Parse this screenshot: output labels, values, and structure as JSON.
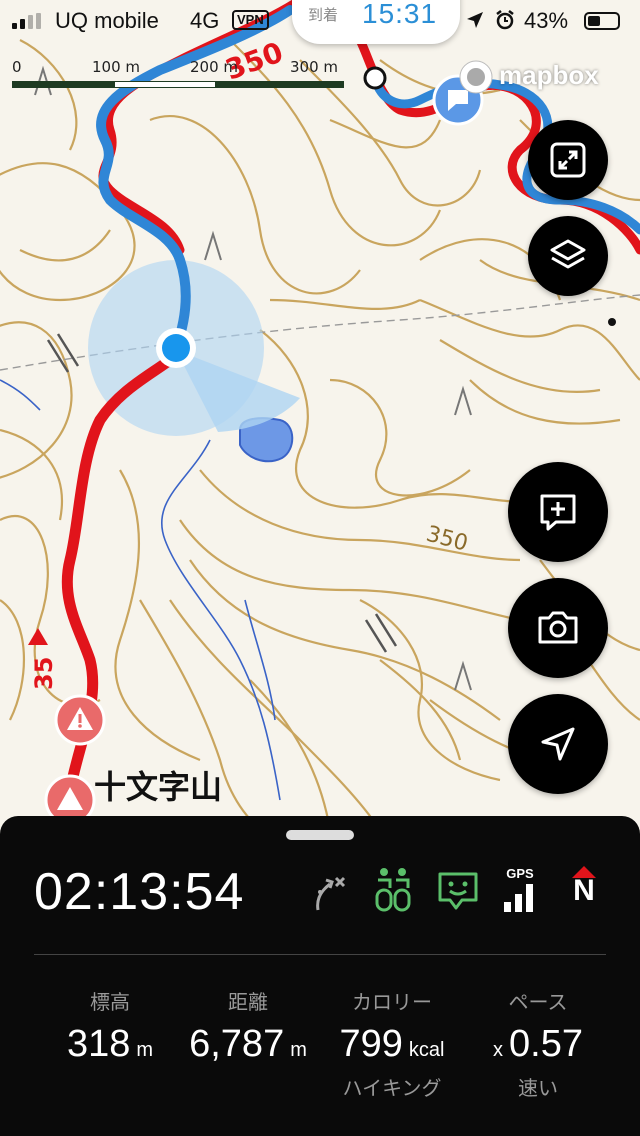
{
  "status_bar": {
    "carrier": "UQ mobile",
    "network": "4G",
    "vpn": "VPN",
    "battery_percent": "43%",
    "battery_level": 0.43,
    "signal_bars": 2
  },
  "arrival": {
    "label": "到着",
    "time": "15:31"
  },
  "scale_bar": {
    "labels": [
      "0",
      "100 m",
      "200 m",
      "300 m"
    ]
  },
  "attribution": "mapbox",
  "map": {
    "peak_name": "十文字山",
    "contour_labels": [
      "350",
      "35",
      "350"
    ]
  },
  "map_buttons": {
    "fullscreen": "fullscreen-toggle",
    "layers": "layers",
    "add_note": "add-memo",
    "camera": "camera",
    "locate": "current-location"
  },
  "panel": {
    "elapsed_time": "02:13:54",
    "status_icons": [
      "route-off-icon",
      "walker-icon",
      "chat-icon",
      "gps-signal-icon",
      "north-compass-icon"
    ],
    "gps_label": "GPS",
    "north_label": "N",
    "stats": [
      {
        "label": "標高",
        "value": "318",
        "unit": "m",
        "prefix": "",
        "sub": ""
      },
      {
        "label": "距離",
        "value": "6,787",
        "unit": "m",
        "prefix": "",
        "sub": ""
      },
      {
        "label": "カロリー",
        "value": "799",
        "unit": "kcal",
        "prefix": "",
        "sub": "ハイキング"
      },
      {
        "label": "ペース",
        "value": "0.57",
        "unit": "",
        "prefix": "x",
        "sub": "速い"
      }
    ]
  },
  "colors": {
    "route_red": "#e1141b",
    "route_blue": "#2f86d6",
    "contour": "#c9a55e",
    "panel_bg": "#0a0a0a",
    "icon_green": "#5bbf6a"
  }
}
